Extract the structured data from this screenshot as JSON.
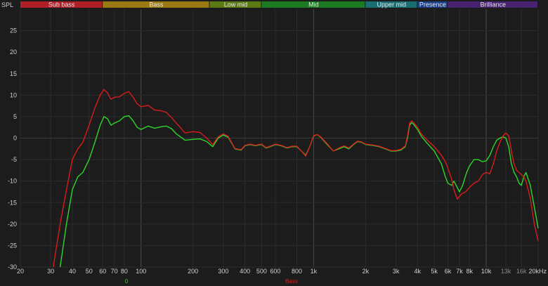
{
  "chart_data": {
    "type": "line",
    "ylabel": "SPL",
    "xscale": "log",
    "xlim": [
      20,
      20000
    ],
    "ylim": [
      -30,
      30
    ],
    "grid": true,
    "bands": [
      {
        "label": "Sub bass",
        "from": 20,
        "to": 60,
        "color": "#b01e28"
      },
      {
        "label": "Bass",
        "from": 60,
        "to": 250,
        "color": "#9a7a12"
      },
      {
        "label": "Low mid",
        "from": 250,
        "to": 500,
        "color": "#5c7a14"
      },
      {
        "label": "Mid",
        "from": 500,
        "to": 2000,
        "color": "#1c7a22"
      },
      {
        "label": "Upper mid",
        "from": 2000,
        "to": 4000,
        "color": "#1a6e72"
      },
      {
        "label": "Presence",
        "from": 4000,
        "to": 6000,
        "color": "#1b3e86"
      },
      {
        "label": "Brilliance",
        "from": 6000,
        "to": 20000,
        "color": "#47226e"
      }
    ],
    "x_ticks": [
      {
        "v": 20,
        "label": "20"
      },
      {
        "v": 30,
        "label": "30"
      },
      {
        "v": 40,
        "label": "40"
      },
      {
        "v": 50,
        "label": "50"
      },
      {
        "v": 60,
        "label": "60"
      },
      {
        "v": 70,
        "label": "70"
      },
      {
        "v": 80,
        "label": "80"
      },
      {
        "v": 100,
        "label": "100"
      },
      {
        "v": 200,
        "label": "200"
      },
      {
        "v": 300,
        "label": "300"
      },
      {
        "v": 400,
        "label": "400"
      },
      {
        "v": 500,
        "label": "500"
      },
      {
        "v": 600,
        "label": "600"
      },
      {
        "v": 800,
        "label": "800"
      },
      {
        "v": 1000,
        "label": "1k"
      },
      {
        "v": 2000,
        "label": "2k"
      },
      {
        "v": 3000,
        "label": "3k"
      },
      {
        "v": 4000,
        "label": "4k"
      },
      {
        "v": 5000,
        "label": "5k"
      },
      {
        "v": 6000,
        "label": "6k"
      },
      {
        "v": 7000,
        "label": "7k"
      },
      {
        "v": 8000,
        "label": "8k"
      },
      {
        "v": 10000,
        "label": "10k"
      },
      {
        "v": 13000,
        "label": "13k",
        "dim": true
      },
      {
        "v": 16000,
        "label": "16k",
        "dim": true
      },
      {
        "v": 20000,
        "label": "20kHz"
      }
    ],
    "y_ticks": [
      {
        "v": 25,
        "label": "25"
      },
      {
        "v": 20,
        "label": "20"
      },
      {
        "v": 15,
        "label": "15"
      },
      {
        "v": 10,
        "label": "10"
      },
      {
        "v": 5,
        "label": "5"
      },
      {
        "v": 0,
        "label": "0"
      },
      {
        "v": -5,
        "label": "-5"
      },
      {
        "v": -10,
        "label": "-10"
      },
      {
        "v": -15,
        "label": "-15"
      },
      {
        "v": -20,
        "label": "-20"
      },
      {
        "v": -25,
        "label": "-25"
      },
      {
        "v": -30,
        "label": "-30"
      }
    ],
    "series": [
      {
        "name": "0",
        "color": "#2ed62e",
        "label_x": 180,
        "points": [
          [
            34,
            -30
          ],
          [
            37,
            -20
          ],
          [
            40,
            -12
          ],
          [
            43,
            -9
          ],
          [
            46,
            -8
          ],
          [
            50,
            -5
          ],
          [
            54,
            -1
          ],
          [
            58,
            3
          ],
          [
            61,
            5
          ],
          [
            64,
            4.5
          ],
          [
            67,
            3
          ],
          [
            70,
            3.5
          ],
          [
            75,
            4
          ],
          [
            80,
            5
          ],
          [
            85,
            5.2
          ],
          [
            90,
            4
          ],
          [
            95,
            2.5
          ],
          [
            100,
            2
          ],
          [
            110,
            2.8
          ],
          [
            120,
            2.3
          ],
          [
            130,
            2.6
          ],
          [
            140,
            2.8
          ],
          [
            150,
            2.2
          ],
          [
            160,
            1
          ],
          [
            180,
            -0.5
          ],
          [
            200,
            -0.3
          ],
          [
            220,
            -0.2
          ],
          [
            240,
            -0.8
          ],
          [
            260,
            -2
          ],
          [
            280,
            0
          ],
          [
            300,
            0.7
          ],
          [
            320,
            0.2
          ],
          [
            350,
            -2.5
          ],
          [
            380,
            -2.8
          ],
          [
            400,
            -1.8
          ],
          [
            430,
            -1.5
          ],
          [
            460,
            -1.8
          ],
          [
            480,
            -1.6
          ],
          [
            500,
            -1.5
          ],
          [
            530,
            -2.3
          ],
          [
            560,
            -2
          ],
          [
            600,
            -1.5
          ],
          [
            650,
            -1.8
          ],
          [
            700,
            -2.3
          ],
          [
            750,
            -2
          ],
          [
            800,
            -2
          ],
          [
            850,
            -3
          ],
          [
            900,
            -4
          ],
          [
            950,
            -2
          ],
          [
            1000,
            0.5
          ],
          [
            1050,
            0.8
          ],
          [
            1100,
            0.2
          ],
          [
            1200,
            -1.5
          ],
          [
            1300,
            -3
          ],
          [
            1400,
            -2.5
          ],
          [
            1500,
            -2
          ],
          [
            1600,
            -2.5
          ],
          [
            1700,
            -1.5
          ],
          [
            1800,
            -0.8
          ],
          [
            1900,
            -1
          ],
          [
            2000,
            -1.5
          ],
          [
            2200,
            -1.7
          ],
          [
            2400,
            -2
          ],
          [
            2600,
            -2.5
          ],
          [
            2800,
            -3
          ],
          [
            3000,
            -3
          ],
          [
            3200,
            -2.8
          ],
          [
            3400,
            -2
          ],
          [
            3500,
            0
          ],
          [
            3600,
            3
          ],
          [
            3700,
            3.6
          ],
          [
            3800,
            3.2
          ],
          [
            4000,
            2
          ],
          [
            4200,
            0.5
          ],
          [
            4500,
            -1
          ],
          [
            5000,
            -3
          ],
          [
            5500,
            -6
          ],
          [
            5800,
            -9
          ],
          [
            6000,
            -10.5
          ],
          [
            6300,
            -11
          ],
          [
            6500,
            -10
          ],
          [
            7000,
            -12.5
          ],
          [
            7300,
            -11
          ],
          [
            7700,
            -8
          ],
          [
            8000,
            -6.5
          ],
          [
            8500,
            -5
          ],
          [
            9000,
            -5
          ],
          [
            9500,
            -5.5
          ],
          [
            10000,
            -5.3
          ],
          [
            10500,
            -4
          ],
          [
            11000,
            -2
          ],
          [
            11500,
            -0.5
          ],
          [
            12000,
            0
          ],
          [
            12500,
            0.3
          ],
          [
            13000,
            0
          ],
          [
            13500,
            -2
          ],
          [
            14000,
            -6
          ],
          [
            14500,
            -8
          ],
          [
            15000,
            -9
          ],
          [
            15500,
            -10.5
          ],
          [
            16000,
            -11
          ],
          [
            16500,
            -9
          ],
          [
            17000,
            -8
          ],
          [
            18000,
            -11
          ],
          [
            19000,
            -16
          ],
          [
            20000,
            -21
          ]
        ]
      },
      {
        "name": "Bass",
        "color": "#d81c1c",
        "label_x": 415,
        "points": [
          [
            31,
            -30
          ],
          [
            34,
            -20
          ],
          [
            37,
            -12
          ],
          [
            40,
            -5
          ],
          [
            43,
            -2.5
          ],
          [
            46,
            -1
          ],
          [
            50,
            3
          ],
          [
            54,
            7
          ],
          [
            58,
            10
          ],
          [
            61,
            11.3
          ],
          [
            64,
            10.5
          ],
          [
            67,
            9
          ],
          [
            70,
            9.5
          ],
          [
            75,
            9.6
          ],
          [
            80,
            10.4
          ],
          [
            85,
            10.8
          ],
          [
            90,
            9.5
          ],
          [
            95,
            8
          ],
          [
            100,
            7.3
          ],
          [
            110,
            7.6
          ],
          [
            120,
            6.5
          ],
          [
            130,
            6.4
          ],
          [
            140,
            6
          ],
          [
            150,
            4.8
          ],
          [
            160,
            3.5
          ],
          [
            180,
            1.2
          ],
          [
            200,
            1.5
          ],
          [
            220,
            1.3
          ],
          [
            240,
            0
          ],
          [
            260,
            -1.5
          ],
          [
            280,
            0.3
          ],
          [
            300,
            1
          ],
          [
            320,
            0.4
          ],
          [
            350,
            -2.4
          ],
          [
            380,
            -2.7
          ],
          [
            400,
            -1.7
          ],
          [
            430,
            -1.4
          ],
          [
            460,
            -1.7
          ],
          [
            480,
            -1.5
          ],
          [
            500,
            -1.4
          ],
          [
            530,
            -2.2
          ],
          [
            560,
            -1.9
          ],
          [
            600,
            -1.4
          ],
          [
            650,
            -1.7
          ],
          [
            700,
            -2.2
          ],
          [
            750,
            -1.9
          ],
          [
            800,
            -1.9
          ],
          [
            850,
            -3
          ],
          [
            900,
            -4.2
          ],
          [
            950,
            -2
          ],
          [
            1000,
            0.6
          ],
          [
            1050,
            0.8
          ],
          [
            1100,
            0.3
          ],
          [
            1200,
            -1.3
          ],
          [
            1300,
            -3
          ],
          [
            1400,
            -2.3
          ],
          [
            1500,
            -1.8
          ],
          [
            1600,
            -2.3
          ],
          [
            1700,
            -1.4
          ],
          [
            1800,
            -0.7
          ],
          [
            1900,
            -0.9
          ],
          [
            2000,
            -1.4
          ],
          [
            2200,
            -1.6
          ],
          [
            2400,
            -1.9
          ],
          [
            2600,
            -2.4
          ],
          [
            2800,
            -2.9
          ],
          [
            3000,
            -2.9
          ],
          [
            3200,
            -2.6
          ],
          [
            3400,
            -1.8
          ],
          [
            3500,
            0.5
          ],
          [
            3600,
            3.5
          ],
          [
            3700,
            4
          ],
          [
            3800,
            3.6
          ],
          [
            4000,
            2.5
          ],
          [
            4200,
            1
          ],
          [
            4500,
            -0.3
          ],
          [
            5000,
            -2
          ],
          [
            5500,
            -4
          ],
          [
            5800,
            -5.5
          ],
          [
            6000,
            -7
          ],
          [
            6300,
            -9.5
          ],
          [
            6500,
            -12
          ],
          [
            6800,
            -14.2
          ],
          [
            7200,
            -13
          ],
          [
            7600,
            -12.5
          ],
          [
            8000,
            -11.5
          ],
          [
            8500,
            -10.5
          ],
          [
            9000,
            -10
          ],
          [
            9500,
            -8.5
          ],
          [
            10000,
            -8
          ],
          [
            10500,
            -8.3
          ],
          [
            11000,
            -6
          ],
          [
            11500,
            -3
          ],
          [
            12000,
            -1
          ],
          [
            12500,
            0.5
          ],
          [
            13000,
            1.2
          ],
          [
            13500,
            0.5
          ],
          [
            14000,
            -3
          ],
          [
            14500,
            -6
          ],
          [
            15000,
            -7.5
          ],
          [
            15500,
            -8
          ],
          [
            16000,
            -8.5
          ],
          [
            16500,
            -9
          ],
          [
            17000,
            -10
          ],
          [
            18000,
            -14
          ],
          [
            19000,
            -20
          ],
          [
            20000,
            -24
          ]
        ]
      }
    ]
  }
}
